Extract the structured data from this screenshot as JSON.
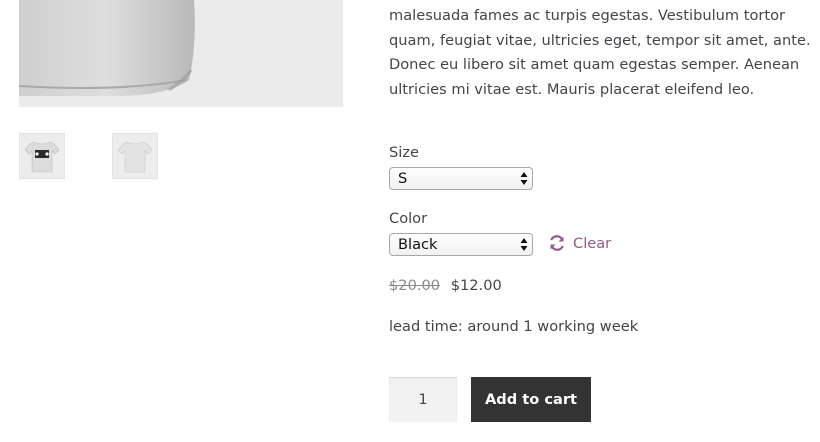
{
  "product": {
    "description": "malesuada fames ac turpis egestas. Vestibulum tortor quam, feugiat vitae, ultricies eget, tempor sit amet, ante. Donec eu libero sit amet quam egestas semper. Aenean ultricies mi vitae est. Mauris placerat eleifend leo.",
    "size_label": "Size",
    "size_value": "S",
    "color_label": "Color",
    "color_value": "Black",
    "clear_label": "Clear",
    "old_price": "$20.00",
    "new_price": "$12.00",
    "lead_time": "lead time: around 1 working week",
    "quantity": "1",
    "add_to_cart_label": "Add to cart"
  },
  "icons": {
    "clear": "refresh-icon",
    "select_arrows": "up-down-arrows-icon"
  },
  "colors": {
    "accent": "#96588a",
    "button_bg": "#333333",
    "text": "#43454b"
  }
}
